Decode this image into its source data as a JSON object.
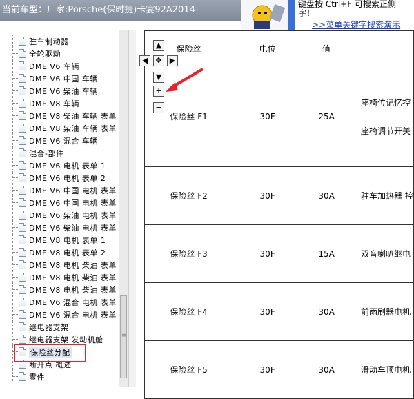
{
  "header": {
    "title": "当前车型：厂家:Porsche(保时捷)卡宴92A2014-",
    "hint_line1": "键盘按   Ctrl+F   可搜索正侧",
    "hint_line2": "字！",
    "search_link": ">>菜单关键字搜索演示"
  },
  "tree": {
    "items": [
      {
        "label": "驻车制动器"
      },
      {
        "label": "全轮驱动"
      },
      {
        "label": "DME V6 车辆"
      },
      {
        "label": "DME V6 中国 车辆"
      },
      {
        "label": "DME V6 柴油 车辆"
      },
      {
        "label": "DME V8 车辆"
      },
      {
        "label": "DME V8 柴油 车辆 表单"
      },
      {
        "label": "DME V8 柴油 车辆 表单"
      },
      {
        "label": "DME V6 混合 车辆"
      },
      {
        "label": "混合-部件"
      },
      {
        "label": "DME V6 电机 表单 1"
      },
      {
        "label": "DME V6 电机 表单 2"
      },
      {
        "label": "DME V6 中国 电机 表单"
      },
      {
        "label": "DME V6 中国 电机 表单"
      },
      {
        "label": "DME V6 柴油 电机 表单"
      },
      {
        "label": "DME V6 柴油 电机 表单"
      },
      {
        "label": "DME V8 电机 表单 1"
      },
      {
        "label": "DME V8 电机 表单 2"
      },
      {
        "label": "DME V8 电机 柴油 表单"
      },
      {
        "label": "DME V8 电机 柴油 表单"
      },
      {
        "label": "DME V8 电机 柴油 表单"
      },
      {
        "label": "DME V6 混合 电机 表单"
      },
      {
        "label": "DME V6 混合 电机 表单"
      },
      {
        "label": "继电器支架"
      },
      {
        "label": "继电器支架 发动机舱"
      },
      {
        "label": "保险丝分配"
      },
      {
        "label": "断开点 概述"
      },
      {
        "label": "零件"
      }
    ],
    "selected_index": 25
  },
  "table": {
    "headers": [
      "保险丝",
      "电位",
      "值",
      ""
    ],
    "rows": [
      {
        "fuse": "保险丝 F1",
        "potential": "30F",
        "value": "25A",
        "desc": [
          "座椅位记忆控",
          "座椅调节开关"
        ]
      },
      {
        "fuse": "保险丝 F2",
        "potential": "30F",
        "value": "30A",
        "desc": [
          "驻车加热器 控"
        ]
      },
      {
        "fuse": "保险丝 F3",
        "potential": "30F",
        "value": "15A",
        "desc": [
          "双音喇叭继电"
        ]
      },
      {
        "fuse": "保险丝 F4",
        "potential": "30F",
        "value": "30A",
        "desc": [
          "前雨刷器电机"
        ]
      },
      {
        "fuse": "保险丝 F5",
        "potential": "30F",
        "value": "30A",
        "desc": [
          "滑动车顶电机"
        ]
      }
    ]
  },
  "nav": {
    "up": "up-arrow-icon",
    "down": "down-arrow-icon",
    "left": "left-arrow-icon",
    "right": "right-arrow-icon",
    "center": "pan-icon",
    "zoom_in": "plus-icon",
    "zoom_out": "minus-icon"
  },
  "colors": {
    "highlight": "#e8212a",
    "link": "#1d3ec0"
  }
}
